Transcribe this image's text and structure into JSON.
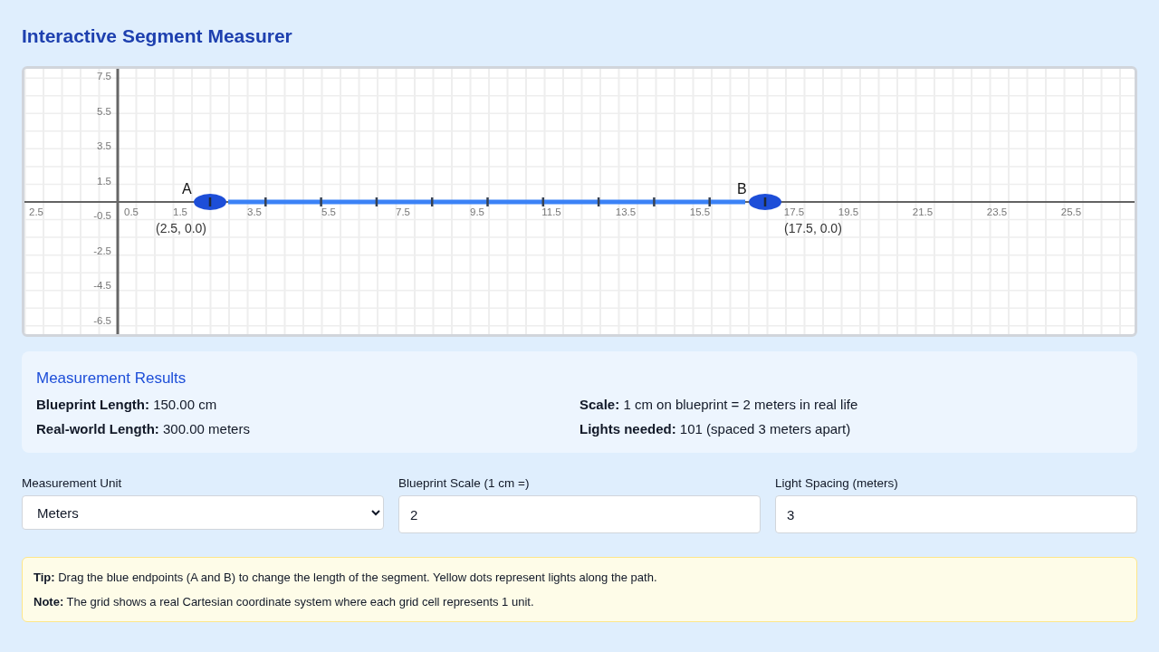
{
  "title": "Interactive Segment Measurer",
  "canvas": {
    "y_axis_labels": [
      "7.5",
      "5.5",
      "3.5",
      "1.5",
      "-0.5",
      "-2.5",
      "-4.5",
      "-6.5"
    ],
    "x_axis_labels": [
      "2.5",
      "0.5",
      "1.5",
      "3.5",
      "5.5",
      "7.5",
      "9.5",
      "11.5",
      "13.5",
      "15.5",
      "17.5",
      "19.5",
      "21.5",
      "23.5",
      "25.5"
    ],
    "endpoints": [
      {
        "label": "A",
        "coords": "(2.5, 0.0)"
      },
      {
        "label": "B",
        "coords": "(17.5, 0.0)"
      }
    ]
  },
  "results": {
    "heading": "Measurement Results",
    "items": [
      {
        "label": "Blueprint Length:",
        "value": "150.00 cm"
      },
      {
        "label": "Scale:",
        "value": "1 cm on blueprint = 2 meters in real life"
      },
      {
        "label": "Real-world Length:",
        "value": "300.00 meters"
      },
      {
        "label": "Lights needed:",
        "value": "101 (spaced 3 meters apart)"
      }
    ]
  },
  "controls": [
    {
      "kind": "select",
      "label": "Measurement Unit",
      "value": "Meters"
    },
    {
      "kind": "number",
      "label": "Blueprint Scale (1 cm =)",
      "value": "2"
    },
    {
      "kind": "number",
      "label": "Light Spacing (meters)",
      "value": "3"
    }
  ],
  "notes": [
    {
      "label": "Tip:",
      "text": "Drag the blue endpoints (A and B) to change the length of the segment. Yellow dots represent lights along the path."
    },
    {
      "label": "Note:",
      "text": "The grid shows a real Cartesian coordinate system where each grid cell represents 1 unit."
    }
  ]
}
